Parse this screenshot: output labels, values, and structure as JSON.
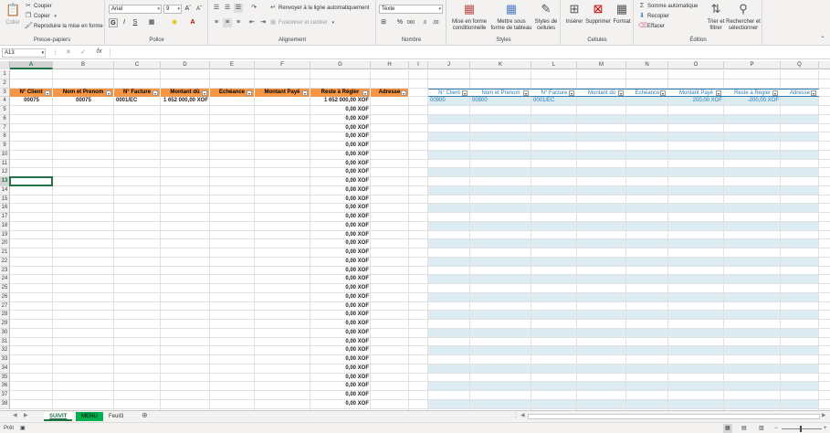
{
  "ribbon": {
    "clipboard": {
      "paste": "Coller",
      "cut": "Couper",
      "copy": "Copier",
      "format_painter": "Reproduire la mise en forme",
      "label": "Presse-papiers"
    },
    "font": {
      "name": "Arial",
      "size": "9",
      "bold": "G",
      "italic": "I",
      "underline": "S",
      "label": "Police"
    },
    "alignment": {
      "wrap": "Renvoyer à la ligne automatiquement",
      "merge": "Fusionner et centrer",
      "label": "Alignement"
    },
    "number": {
      "format": "Texte",
      "label": "Nombre"
    },
    "styles": {
      "conditional": "Mise en forme conditionnelle",
      "table": "Mettre sous forme de tableau",
      "cell_styles": "Styles de cellules",
      "label": "Styles"
    },
    "cells": {
      "insert": "Insérer",
      "delete": "Supprimer",
      "format": "Format",
      "label": "Cellules"
    },
    "editing": {
      "autosum": "Somme automatique",
      "fill": "Recopier",
      "clear": "Effacer",
      "sort": "Trier et filtrer",
      "find": "Rechercher et sélectionner",
      "label": "Édition"
    }
  },
  "formula_bar": {
    "name_box": "A13",
    "fx": "fx",
    "value": ""
  },
  "columns": [
    "A",
    "B",
    "C",
    "D",
    "E",
    "F",
    "G",
    "H",
    "I",
    "J",
    "K",
    "L",
    "M",
    "N",
    "O",
    "P",
    "Q"
  ],
  "rows": [
    "1",
    "2",
    "3",
    "4",
    "5",
    "6",
    "7",
    "8",
    "9",
    "10",
    "11",
    "12",
    "13",
    "14",
    "15",
    "16",
    "17",
    "18",
    "19",
    "20",
    "21",
    "22",
    "23",
    "24",
    "25",
    "26",
    "27",
    "28",
    "29",
    "30",
    "31",
    "32",
    "33",
    "34",
    "35",
    "36",
    "37",
    "38"
  ],
  "left_table": {
    "headers": [
      "N° Client",
      "Nom et Prenom",
      "N° Facture",
      "Montant dû",
      "Echéance",
      "Montant Payé",
      "Reste à Régler",
      "Adresse"
    ],
    "first_row": [
      "00075",
      "00075",
      "0001/EC",
      "1 652 000,00 XOF",
      "",
      "",
      "1 652 000,00 XOF",
      ""
    ],
    "zero_value": "0,00 XOF"
  },
  "right_table": {
    "headers": [
      "N° Client",
      "Nom et Prenom",
      "N° Facture",
      "Montant dû",
      "Echéance",
      "Montant Payé",
      "Reste à Régler",
      "Adresse"
    ],
    "first_row": [
      "00900",
      "00900",
      "0001/EC",
      "",
      "",
      "200,00 XOF",
      "-200,00 XOF",
      ""
    ]
  },
  "sheets": [
    {
      "name": "SUIVIT",
      "active": true
    },
    {
      "name": "MENU",
      "active": false
    },
    {
      "name": "Feuil3",
      "active": false
    }
  ],
  "status": {
    "ready": "Prêt"
  },
  "colors": {
    "orange_header": "#f79646",
    "excel_green": "#217346",
    "band_blue": "#dcecf2",
    "blue_text": "#2f7db3",
    "menu_tab": "#00b050"
  }
}
